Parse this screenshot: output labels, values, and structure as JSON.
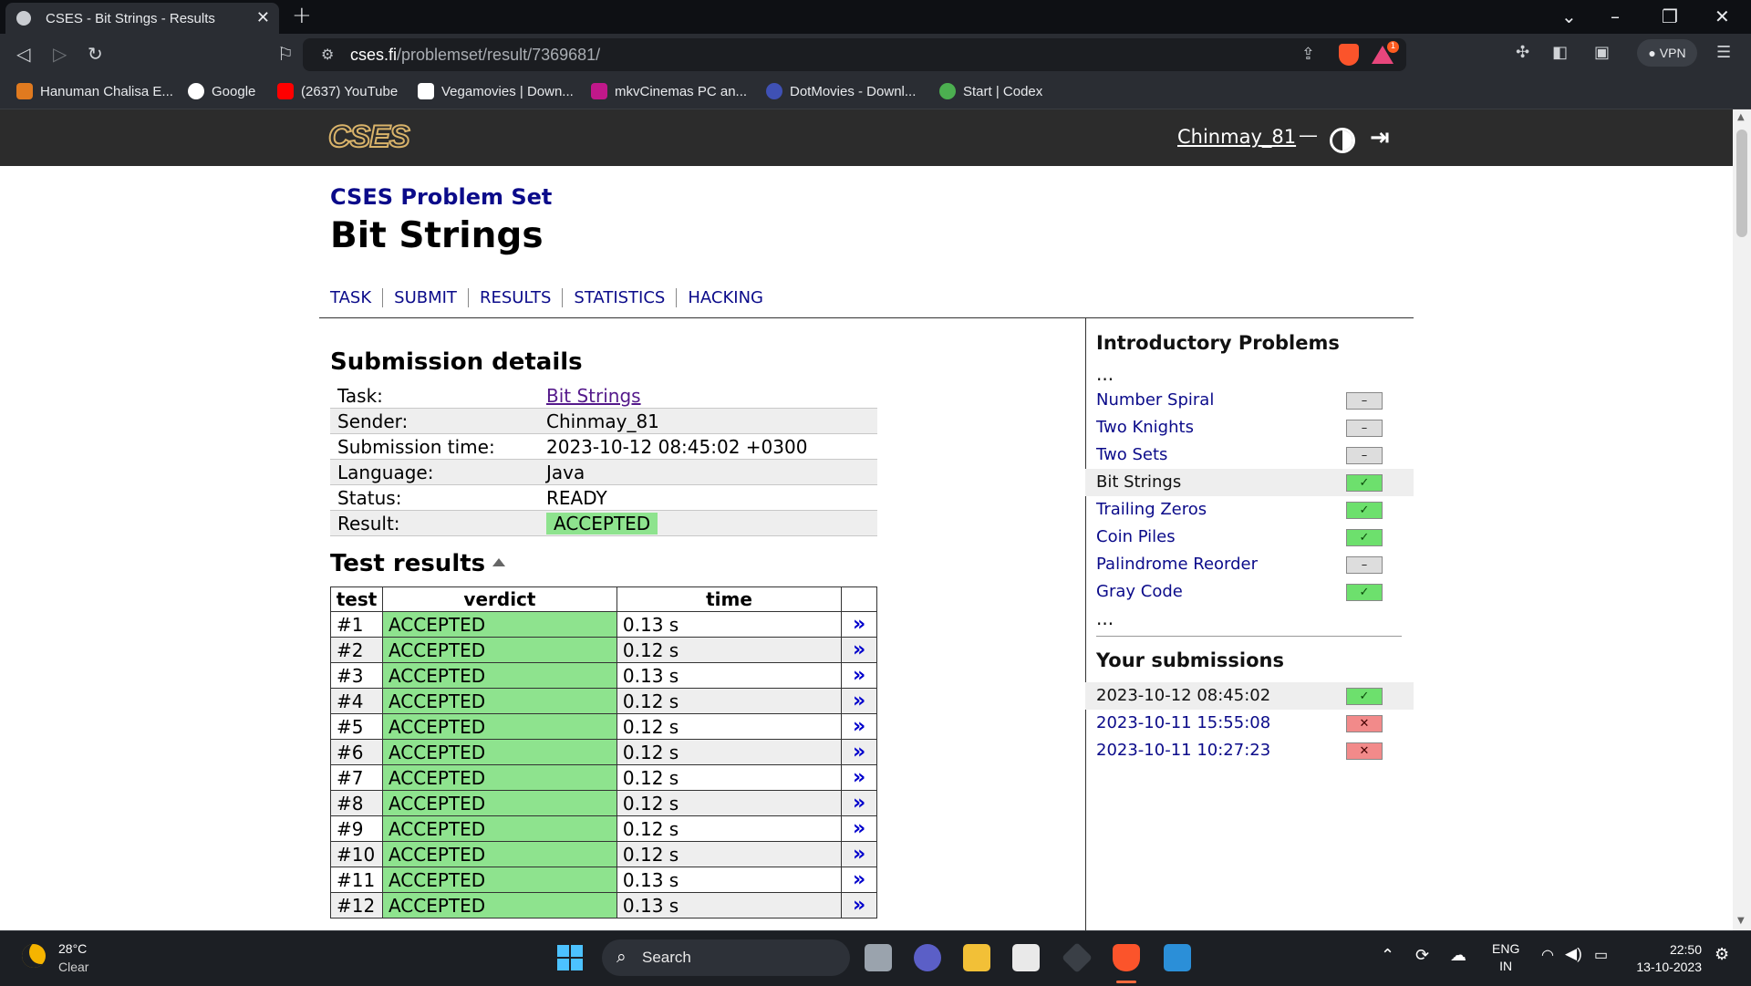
{
  "browser": {
    "tab_title": "CSES - Bit Strings - Results",
    "url_host": "cses.fi",
    "url_path": "/problemset/result/7369681/",
    "vpn_label": "VPN",
    "rewards_badge": "1",
    "bookmarks": [
      {
        "label": "Hanuman Chalisa E...",
        "icon_color": "#e07a1f"
      },
      {
        "label": "Google",
        "icon_color": "#ffffff"
      },
      {
        "label": "(2637) YouTube",
        "icon_color": "#ff0000"
      },
      {
        "label": "Vegamovies | Down...",
        "icon_color": "#ffffff"
      },
      {
        "label": "mkvCinemas PC an...",
        "icon_color": "#c0188a"
      },
      {
        "label": "DotMovies - Downl...",
        "icon_color": "#3f51b5"
      },
      {
        "label": "Start | Codex",
        "icon_color": "#4caf50"
      }
    ]
  },
  "site": {
    "logo": "CSES",
    "username": "Chinmay_81",
    "header_dash": "—"
  },
  "page": {
    "breadcrumb": "CSES Problem Set",
    "title": "Bit Strings",
    "nav": [
      "TASK",
      "SUBMIT",
      "RESULTS",
      "STATISTICS",
      "HACKING"
    ]
  },
  "details": {
    "heading": "Submission details",
    "rows": [
      {
        "label": "Task:",
        "value": "Bit Strings"
      },
      {
        "label": "Sender:",
        "value": "Chinmay_81"
      },
      {
        "label": "Submission time:",
        "value": "2023-10-12 08:45:02 +0300"
      },
      {
        "label": "Language:",
        "value": "Java"
      },
      {
        "label": "Status:",
        "value": "READY"
      },
      {
        "label": "Result:",
        "value": "ACCEPTED"
      }
    ]
  },
  "tests": {
    "heading": "Test results",
    "columns": [
      "test",
      "verdict",
      "time",
      ""
    ],
    "link_glyph": "»",
    "rows": [
      {
        "test": "#1",
        "verdict": "ACCEPTED",
        "time": "0.13 s"
      },
      {
        "test": "#2",
        "verdict": "ACCEPTED",
        "time": "0.12 s"
      },
      {
        "test": "#3",
        "verdict": "ACCEPTED",
        "time": "0.13 s"
      },
      {
        "test": "#4",
        "verdict": "ACCEPTED",
        "time": "0.12 s"
      },
      {
        "test": "#5",
        "verdict": "ACCEPTED",
        "time": "0.12 s"
      },
      {
        "test": "#6",
        "verdict": "ACCEPTED",
        "time": "0.12 s"
      },
      {
        "test": "#7",
        "verdict": "ACCEPTED",
        "time": "0.12 s"
      },
      {
        "test": "#8",
        "verdict": "ACCEPTED",
        "time": "0.12 s"
      },
      {
        "test": "#9",
        "verdict": "ACCEPTED",
        "time": "0.12 s"
      },
      {
        "test": "#10",
        "verdict": "ACCEPTED",
        "time": "0.12 s"
      },
      {
        "test": "#11",
        "verdict": "ACCEPTED",
        "time": "0.13 s"
      },
      {
        "test": "#12",
        "verdict": "ACCEPTED",
        "time": "0.13 s"
      }
    ]
  },
  "sidebar": {
    "problems_heading": "Introductory Problems",
    "ellipsis": "...",
    "problems": [
      {
        "name": "Number Spiral",
        "status": "none",
        "current": false
      },
      {
        "name": "Two Knights",
        "status": "none",
        "current": false
      },
      {
        "name": "Two Sets",
        "status": "none",
        "current": false
      },
      {
        "name": "Bit Strings",
        "status": "ok",
        "current": true
      },
      {
        "name": "Trailing Zeros",
        "status": "ok",
        "current": false
      },
      {
        "name": "Coin Piles",
        "status": "ok",
        "current": false
      },
      {
        "name": "Palindrome Reorder",
        "status": "none",
        "current": false
      },
      {
        "name": "Gray Code",
        "status": "ok",
        "current": false
      }
    ],
    "submissions_heading": "Your submissions",
    "submissions": [
      {
        "time": "2023-10-12 08:45:02",
        "status": "ok",
        "current": true
      },
      {
        "time": "2023-10-11 15:55:08",
        "status": "fail",
        "current": false
      },
      {
        "time": "2023-10-11 10:27:23",
        "status": "fail",
        "current": false
      }
    ],
    "marks": {
      "none": "–",
      "ok": "✓",
      "fail": "✕"
    }
  },
  "taskbar": {
    "temperature": "28°C",
    "condition": "Clear",
    "search_placeholder": "Search",
    "lang": "ENG",
    "region": "IN",
    "time": "22:50",
    "date": "13-10-2023"
  },
  "colors": {
    "accepted_bg": "#8ee38e",
    "link": "#0b0b8a",
    "header_bg": "#2c2c2c"
  }
}
